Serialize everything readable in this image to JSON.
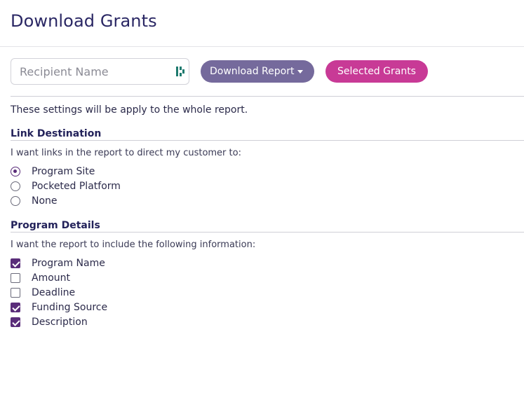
{
  "header": {
    "title": "Download Grants"
  },
  "toolbar": {
    "search_placeholder": "Recipient Name",
    "download_label": "Download Report",
    "selected_label": "Selected Grants"
  },
  "note": "These settings will be apply to the whole report.",
  "link_destination": {
    "title": "Link Destination",
    "description": "I want links in the report to direct my customer to:",
    "options": [
      {
        "label": "Program Site",
        "checked": true
      },
      {
        "label": "Pocketed Platform",
        "checked": false
      },
      {
        "label": "None",
        "checked": false
      }
    ]
  },
  "program_details": {
    "title": "Program Details",
    "description": "I want the report to include the following information:",
    "options": [
      {
        "label": "Program Name",
        "checked": true
      },
      {
        "label": "Amount",
        "checked": false
      },
      {
        "label": "Deadline",
        "checked": false
      },
      {
        "label": "Funding Source",
        "checked": true
      },
      {
        "label": "Description",
        "checked": true
      }
    ]
  },
  "colors": {
    "title": "#2a2764",
    "download_button": "#756a9c",
    "selected_button": "#c83a96",
    "accent": "#5a2d7a"
  }
}
